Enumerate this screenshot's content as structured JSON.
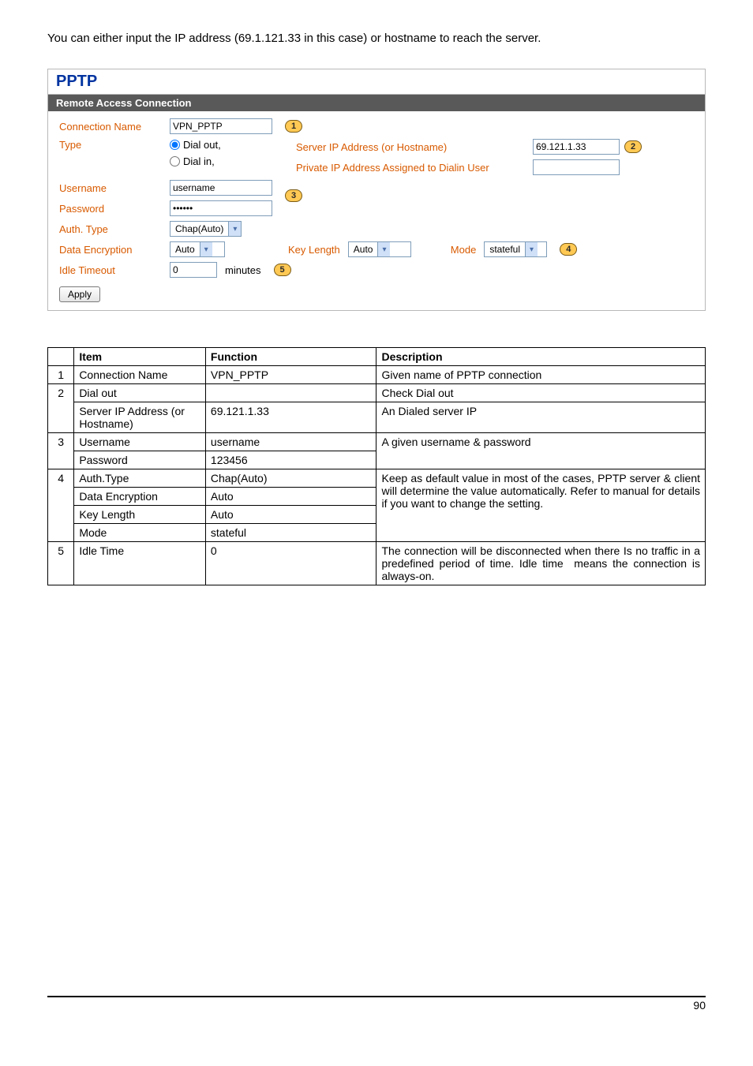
{
  "intro": "You can either input the IP address (69.1.121.33 in this case) or hostname to reach the server.",
  "panel": {
    "title": "PPTP",
    "subtitle": "Remote Access Connection",
    "conn_name_label": "Connection Name",
    "conn_name_value": "VPN_PPTP",
    "type_label": "Type",
    "dial_out_label": "Dial out,",
    "dial_in_label": "Dial in,",
    "server_ip_label": "Server IP Address (or Hostname)",
    "server_ip_value": "69.121.1.33",
    "private_ip_label": "Private IP Address Assigned to Dialin User",
    "private_ip_value": "",
    "username_label": "Username",
    "username_value": "username",
    "password_label": "Password",
    "password_value": "••••••",
    "auth_type_label": "Auth. Type",
    "auth_type_value": "Chap(Auto)",
    "data_enc_label": "Data Encryption",
    "data_enc_value": "Auto",
    "key_length_label": "Key Length",
    "key_length_value": "Auto",
    "mode_label": "Mode",
    "mode_value": "stateful",
    "idle_label": "Idle Timeout",
    "idle_value": "0",
    "idle_unit": "minutes",
    "apply_label": "Apply",
    "badges": {
      "b1": "1",
      "b2": "2",
      "b3": "3",
      "b4": "4",
      "b5": "5"
    }
  },
  "table": {
    "headers": {
      "h1": "",
      "h2": "Item",
      "h3": "Function",
      "h4": "Description"
    },
    "r1": {
      "num": "1",
      "item": "Connection Name",
      "val": "VPN_PPTP",
      "desc": "Given name of PPTP connection"
    },
    "r2": {
      "num": "2",
      "item": "Dial out",
      "val": "",
      "desc": "Check Dial out"
    },
    "r3": {
      "item": "Server IP Address (or Hostname)",
      "val": "69.121.1.33",
      "desc": "An Dialed server IP"
    },
    "r4": {
      "num": "3",
      "item": "Username",
      "val": "username",
      "desc": "A given username & password"
    },
    "r5": {
      "item": "Password",
      "val": "123456"
    },
    "r6": {
      "num": "4",
      "item": "Auth.Type",
      "val": "Chap(Auto)",
      "desc": "Keep as default value in most of the cases, PPTP server & client will determine the value automatically.  Refer to manual for details if you want to change the setting."
    },
    "r7": {
      "item": "Data Encryption",
      "val": "Auto"
    },
    "r8": {
      "item": "Key Length",
      "val": "Auto"
    },
    "r9": {
      "item": "Mode",
      "val": "stateful"
    },
    "r10": {
      "num": "5",
      "item": "Idle Time",
      "val": "0",
      "desc": "The connection will be disconnected when there Is no traffic in a predefined period of time. Idle time ​ means the connection is always-on."
    }
  },
  "page_number": "90"
}
